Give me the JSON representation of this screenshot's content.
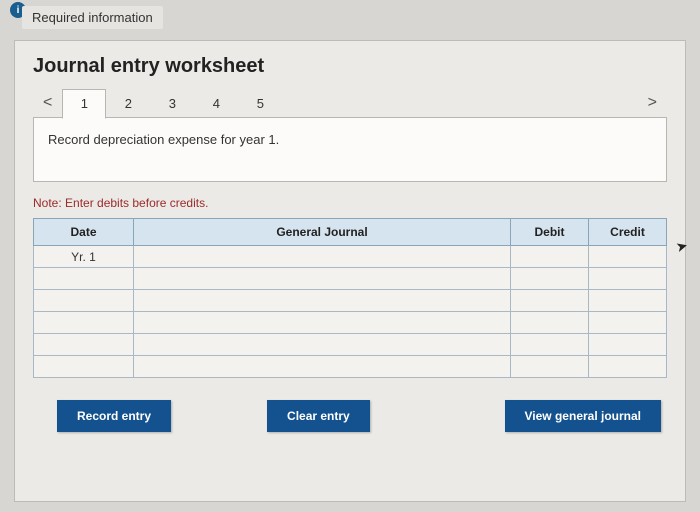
{
  "badge": "i",
  "required_info": "Required information",
  "title": "Journal entry worksheet",
  "chev_left": "<",
  "chev_right": ">",
  "tabs": [
    "1",
    "2",
    "3",
    "4",
    "5"
  ],
  "active_tab_index": 0,
  "instruction": "Record depreciation expense for year 1.",
  "note": "Note: Enter debits before credits.",
  "table": {
    "headers": {
      "date": "Date",
      "gj": "General Journal",
      "debit": "Debit",
      "credit": "Credit"
    },
    "rows": [
      {
        "date": "Yr. 1",
        "gj": "",
        "debit": "",
        "credit": ""
      },
      {
        "date": "",
        "gj": "",
        "debit": "",
        "credit": ""
      },
      {
        "date": "",
        "gj": "",
        "debit": "",
        "credit": ""
      },
      {
        "date": "",
        "gj": "",
        "debit": "",
        "credit": ""
      },
      {
        "date": "",
        "gj": "",
        "debit": "",
        "credit": ""
      },
      {
        "date": "",
        "gj": "",
        "debit": "",
        "credit": ""
      }
    ]
  },
  "buttons": {
    "record": "Record entry",
    "clear": "Clear entry",
    "view": "View general journal"
  }
}
